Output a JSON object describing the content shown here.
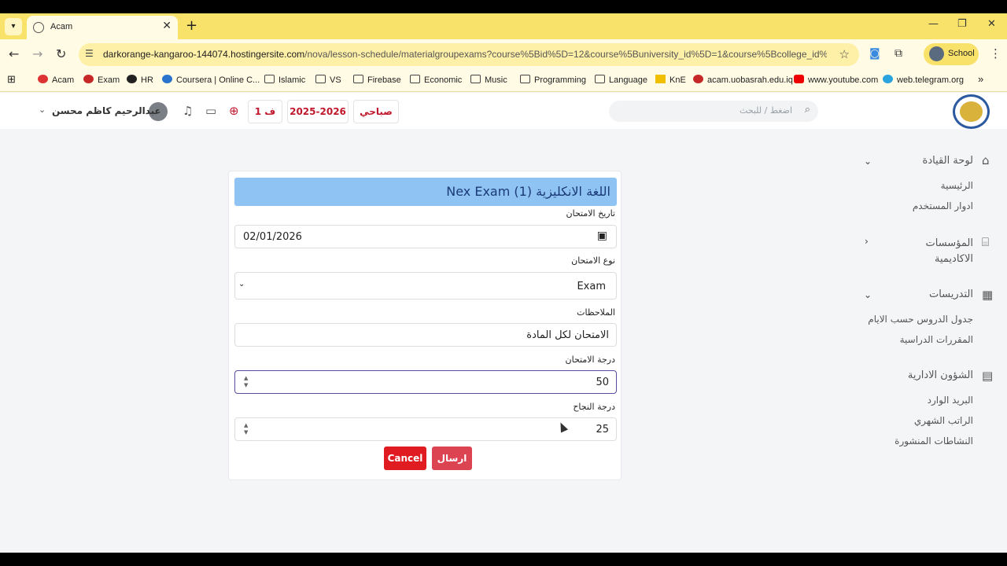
{
  "browser": {
    "tab_title": "Acam",
    "url_host": "darkorange-kangaroo-144074.hostingersite.com",
    "url_path": "/nova/lesson-schedule/materialgroupexams?course%5Bid%5D=12&course%5Buniversity_id%5D=1&course%5Bcollege_id%5D=...",
    "profile_label": "School",
    "bookmarks": [
      "Acam",
      "Exam",
      "HR",
      "Coursera | Online C...",
      "Islamic",
      "VS",
      "Firebase",
      "Economic",
      "Music",
      "Programming",
      "Language",
      "KnE",
      "acam.uobasrah.edu.iq",
      "www.youtube.com",
      "web.telegram.org"
    ]
  },
  "header": {
    "search_placeholder": "اضغط / للبحث",
    "shift": "صباحي",
    "year": "2025-2026",
    "semester": "ف 1",
    "user_name": "عبدالرحيم كاظم محسن"
  },
  "sidebar": {
    "dashboard": "لوحة القيادة",
    "dashboard_items": [
      "الرئيسية",
      "ادوار المستخدم"
    ],
    "institutions": "المؤسسات الاكاديمية",
    "teaching": "التدريسات",
    "teaching_items": [
      "جدول الدروس حسب الايام",
      "المقررات الدراسية"
    ],
    "admin": "الشؤون الادارية",
    "admin_items": [
      "البريد الوارد",
      "الراتب الشهري",
      "النشاطات المنشورة"
    ]
  },
  "form": {
    "title": "اللغة الانكليزية (1) Nex Exam",
    "date_label": "تاريخ الامتحان",
    "date_value": "02/01/2026",
    "type_label": "نوع الامتحان",
    "type_value": "Exam",
    "notes_label": "الملاحظات",
    "notes_value": "الامتحان لكل المادة",
    "grade_label": "درجة الامتحان",
    "grade_value": "50",
    "pass_label": "درجة النجاح",
    "pass_value": "25",
    "cancel": "Cancel",
    "submit": "ارسال"
  },
  "colors": {
    "browser_chrome": "#f8e26a",
    "title_bar": "#8ec3f3",
    "cancel_button": "#e11b22",
    "submit_button": "#dc4452",
    "header_accent": "#c0182c"
  }
}
